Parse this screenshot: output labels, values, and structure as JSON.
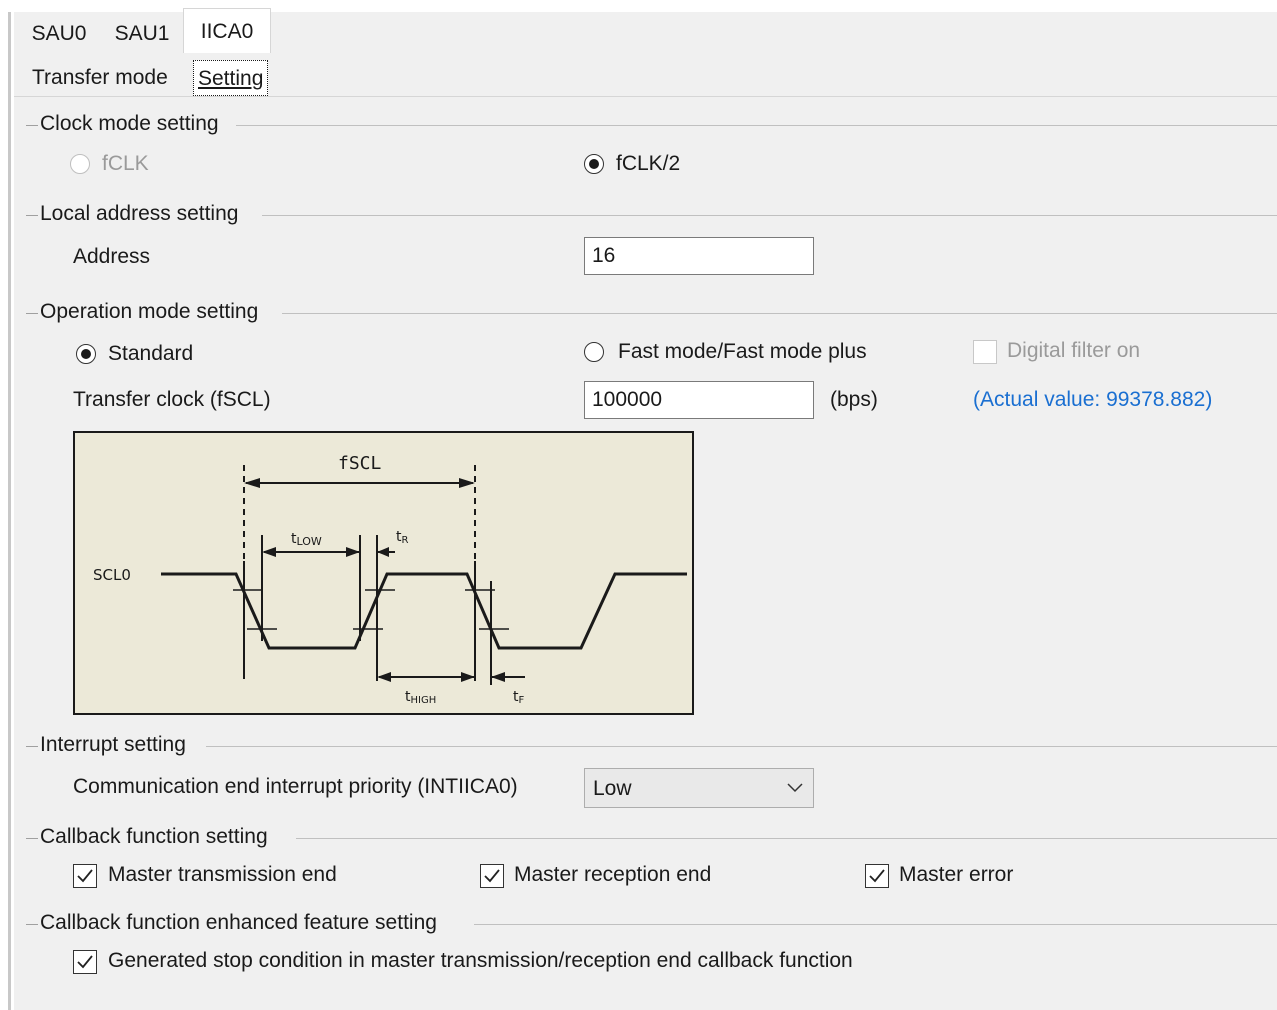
{
  "tabs": [
    "SAU0",
    "SAU1",
    "IICA0"
  ],
  "subtabs": [
    "Transfer mode",
    "Setting"
  ],
  "clock": {
    "heading": "Clock mode setting",
    "option1": "fCLK",
    "option2": "fCLK/2",
    "selected": "fCLK/2"
  },
  "local_address": {
    "heading": "Local address setting",
    "label": "Address",
    "value": "16"
  },
  "operation": {
    "heading": "Operation mode setting",
    "standard": "Standard",
    "fast": "Fast mode/Fast mode plus",
    "digital_filter": "Digital filter on",
    "selected": "Standard",
    "transfer_clock_label": "Transfer clock (fSCL)",
    "transfer_clock_value": "100000",
    "unit": "(bps)",
    "actual_value": "(Actual value: 99378.882)"
  },
  "diagram": {
    "fscl": "fSCL",
    "tlow_main": "t",
    "tlow_sub": "LOW",
    "tr_main": "t",
    "tr_sub": "R",
    "signal": "SCL0",
    "thigh_main": "t",
    "thigh_sub": "HIGH",
    "tf_main": "t",
    "tf_sub": "F"
  },
  "interrupt": {
    "heading": "Interrupt setting",
    "label": "Communication end interrupt priority (INTIICA0)",
    "value": "Low"
  },
  "callback": {
    "heading": "Callback function setting",
    "items": [
      "Master transmission end",
      "Master reception end",
      "Master error"
    ],
    "checked": [
      true,
      true,
      true
    ]
  },
  "callback_enhanced": {
    "heading": "Callback function enhanced feature setting",
    "item": "Generated stop condition in master transmission/reception end callback function",
    "checked": true
  },
  "colors": {
    "panel_bg": "#f0f0f0",
    "diagram_bg": "#ece9d8",
    "link_blue": "#1a6fd1"
  }
}
